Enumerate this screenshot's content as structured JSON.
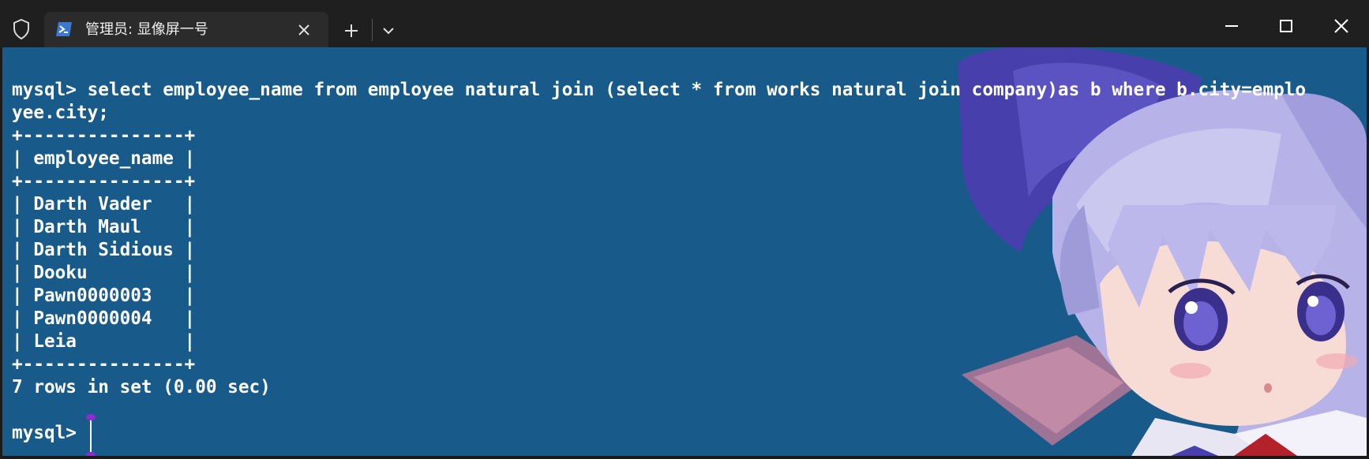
{
  "titlebar": {
    "tab_title": "管理员: 显像屏一号",
    "icons": [
      "shield-icon",
      "powershell-icon",
      "close-icon",
      "plus-icon",
      "chevron-down-icon",
      "minimize-icon",
      "maximize-icon",
      "close-window-icon"
    ]
  },
  "terminal": {
    "background_color": "#185a8a",
    "text_color": "#ffffff",
    "lines": [
      "mysql> select employee_name from employee natural join (select * from works natural join company)as b where b.city=emplo",
      "yee.city;",
      "+---------------+",
      "| employee_name |",
      "+---------------+",
      "| Darth Vader   |",
      "| Darth Maul    |",
      "| Darth Sidious |",
      "| Dooku         |",
      "| Pawn0000003   |",
      "| Pawn0000004   |",
      "| Leia          |",
      "+---------------+",
      "7 rows in set (0.00 sec)",
      "",
      "mysql> "
    ]
  }
}
